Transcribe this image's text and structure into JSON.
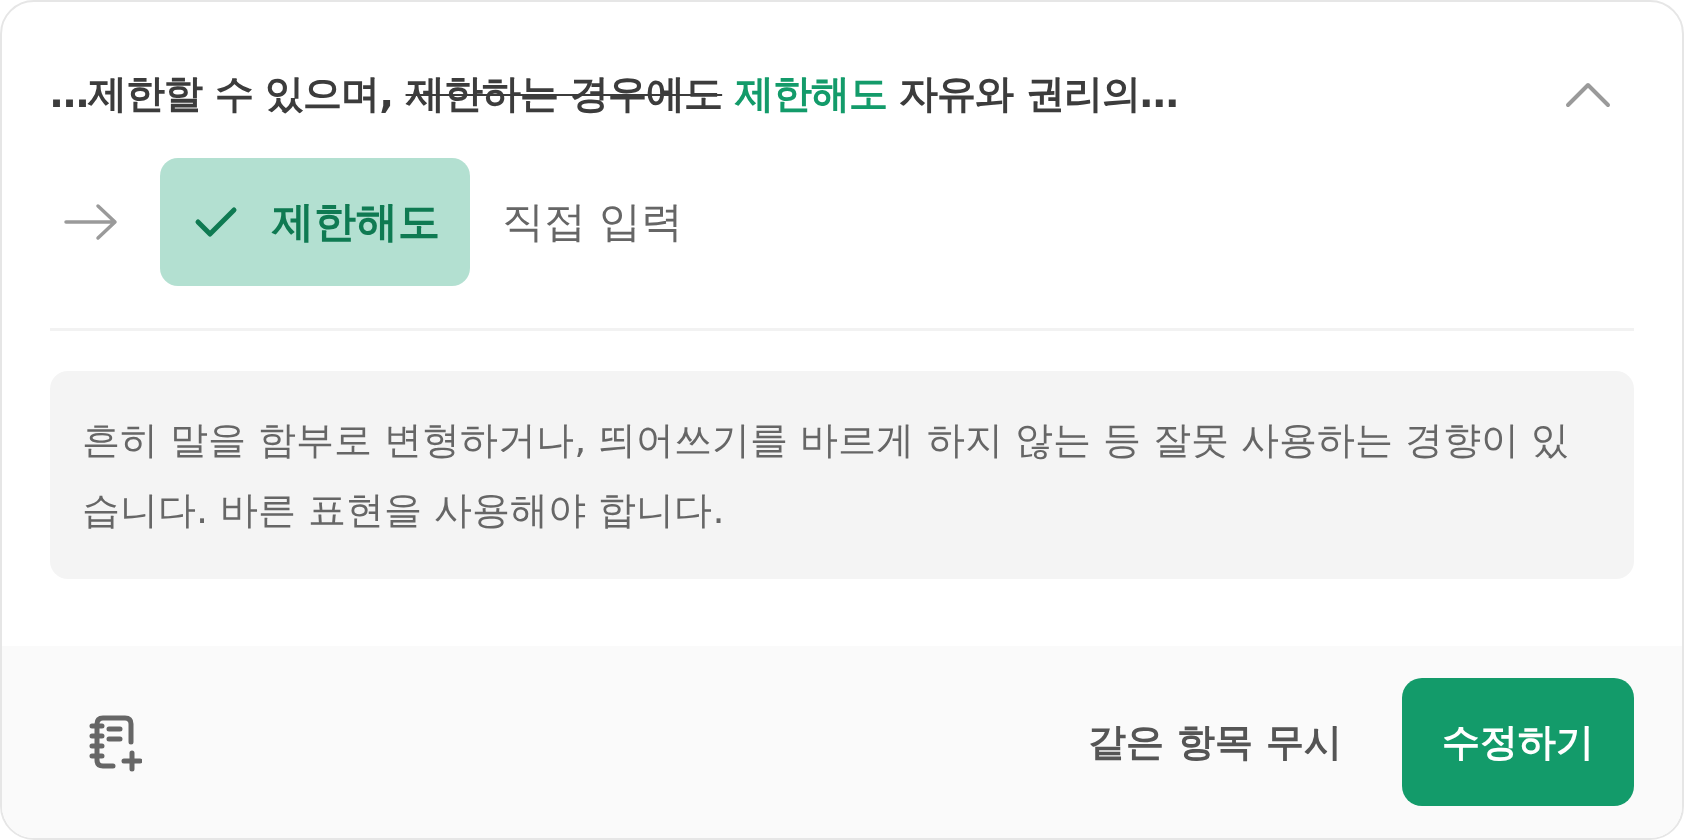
{
  "header": {
    "segments": [
      {
        "kind": "plain",
        "text": "…제한할 수 있으며, "
      },
      {
        "kind": "deleted",
        "text": "제한하는 경우에도"
      },
      {
        "kind": "inserted",
        "text": " 제한해도"
      },
      {
        "kind": "plain",
        "text": " 자유와 권리의…"
      }
    ],
    "expanded": true
  },
  "options": [
    {
      "label": "제한해도",
      "selected": true
    },
    {
      "label": "직접 입력",
      "selected": false
    }
  ],
  "description": "흔히 말을 함부로 변형하거나, 띄어쓰기를 바르게 하지 않는 등 잘못 사용하는 경향이 있습니다. 바른 표현을 사용해야 합니다.",
  "footer": {
    "ignore_button": "같은 항목 무시",
    "apply_button": "수정하기"
  }
}
